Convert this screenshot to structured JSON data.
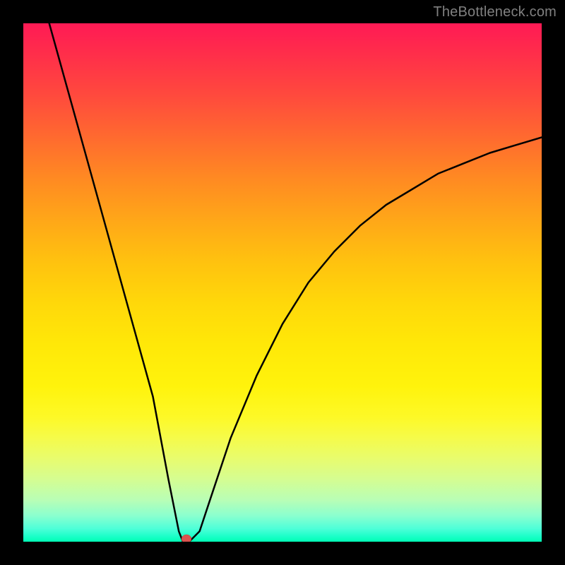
{
  "watermark": "TheBottleneck.com",
  "chart_data": {
    "type": "line",
    "title": "",
    "xlabel": "",
    "ylabel": "",
    "xlim": [
      0,
      100
    ],
    "ylim": [
      0,
      100
    ],
    "grid": false,
    "background": "rainbow-vertical-gradient",
    "series": [
      {
        "name": "bottleneck-curve",
        "color": "#000000",
        "x": [
          5,
          10,
          15,
          20,
          25,
          28,
          30,
          31,
          32,
          34,
          36,
          40,
          45,
          50,
          55,
          60,
          65,
          70,
          75,
          80,
          85,
          90,
          95,
          100
        ],
        "y": [
          100,
          82,
          64,
          46,
          28,
          12,
          2,
          0,
          0,
          2,
          8,
          20,
          32,
          42,
          50,
          56,
          61,
          65,
          68,
          71,
          73,
          75,
          76.5,
          78
        ]
      }
    ],
    "marker": {
      "name": "optimal-point",
      "x": 31.5,
      "y": 0,
      "color": "#d9534f",
      "shape": "ellipse"
    },
    "annotations": []
  }
}
